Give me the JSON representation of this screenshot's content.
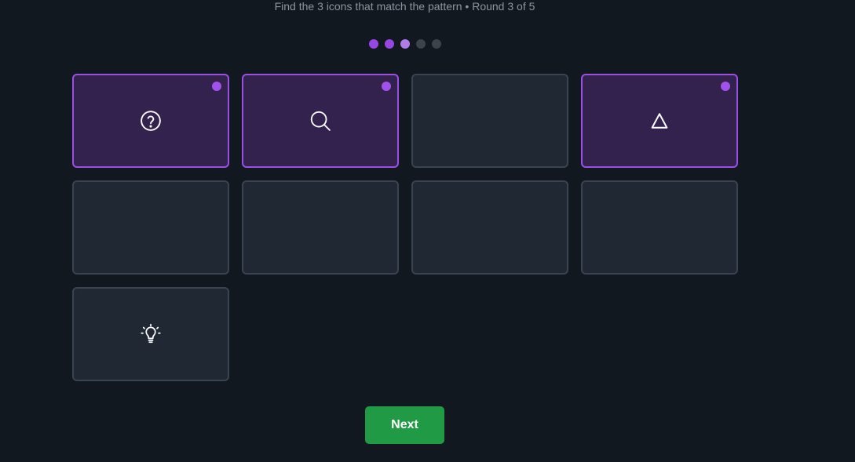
{
  "header": {
    "instruction": "Find the 3 icons that match the pattern • Round 3 of 5"
  },
  "progress": {
    "total_rounds": 5,
    "completed": 2,
    "current": 3
  },
  "tiles": [
    {
      "icon": "question-circle-icon",
      "selected": true
    },
    {
      "icon": "search-icon",
      "selected": true
    },
    {
      "icon": null,
      "selected": false
    },
    {
      "icon": "triangle-icon",
      "selected": true
    },
    {
      "icon": null,
      "selected": false
    },
    {
      "icon": null,
      "selected": false
    },
    {
      "icon": null,
      "selected": false
    },
    {
      "icon": null,
      "selected": false
    },
    {
      "icon": "lightbulb-icon",
      "selected": false
    }
  ],
  "actions": {
    "next_label": "Next"
  },
  "colors": {
    "background": "#121820",
    "tile": "#1f2833",
    "tile_selected": "#33224e",
    "accent": "#9746e4",
    "next_button": "#219a45"
  }
}
